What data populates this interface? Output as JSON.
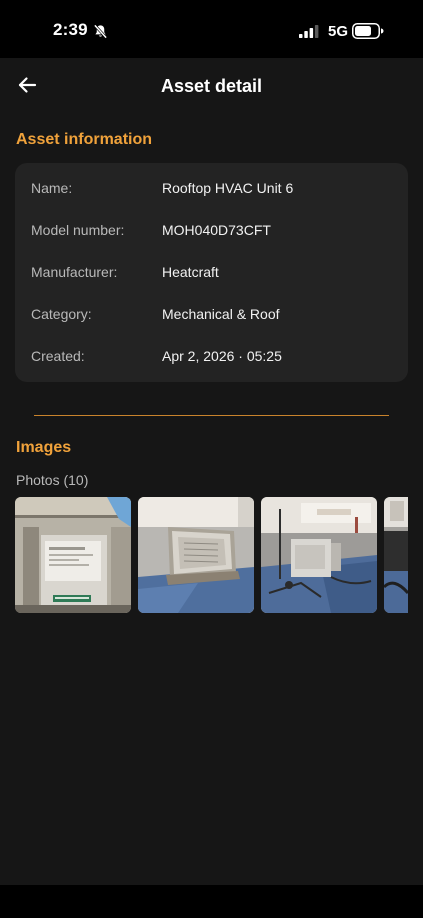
{
  "status_bar": {
    "time": "2:39",
    "network": "5G",
    "icons": [
      "bell-slash-icon",
      "signal-bars-icon",
      "battery-icon"
    ]
  },
  "header": {
    "title": "Asset detail",
    "back_icon": "arrow-left-icon"
  },
  "asset_information": {
    "title": "Asset information",
    "rows": [
      {
        "label": "Name:",
        "value": "Rooftop HVAC Unit 6"
      },
      {
        "label": "Model number:",
        "value": "MOH040D73CFT"
      },
      {
        "label": "Manufacturer:",
        "value": "Heatcraft"
      },
      {
        "label": "Category:",
        "value": "Mechanical & Roof"
      },
      {
        "label": "Created:",
        "value": "Apr 2, 2026 · 05:25"
      }
    ]
  },
  "images": {
    "title": "Images",
    "photos_label": "Photos (10)",
    "photos": [
      "hvac-panel-photo",
      "condenser-unit-photo",
      "rooftop-unit-photo",
      "rooftop-partial-photo"
    ]
  },
  "colors": {
    "accent": "#f0a23b",
    "background": "#161616",
    "card": "#232323",
    "divider": "#c9832c"
  }
}
